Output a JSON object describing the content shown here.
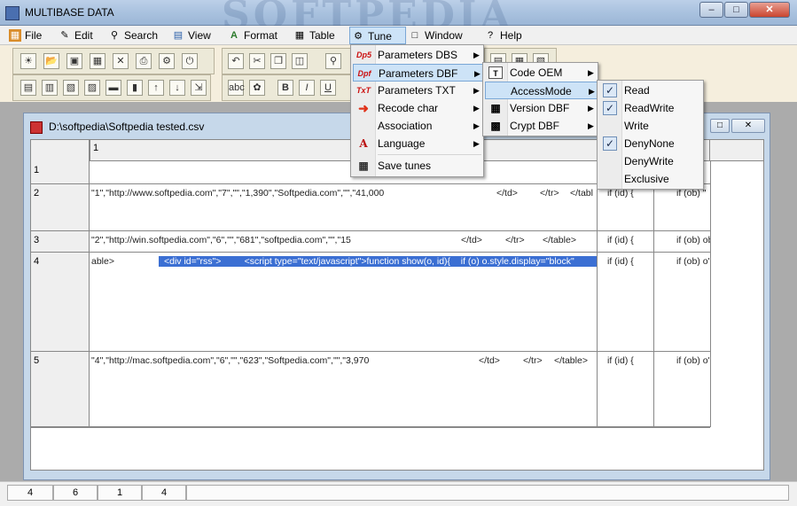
{
  "window": {
    "title": "MULTIBASE DATA",
    "watermark": "SOFTPEDIA"
  },
  "menubar": [
    {
      "label": "File",
      "icon": "file-icon"
    },
    {
      "label": "Edit",
      "icon": "edit-icon"
    },
    {
      "label": "Search",
      "icon": "search-icon"
    },
    {
      "label": "View",
      "icon": "view-icon"
    },
    {
      "label": "Format",
      "icon": "format-icon"
    },
    {
      "label": "Table",
      "icon": "table-icon"
    },
    {
      "label": "Tune",
      "icon": "tune-icon"
    },
    {
      "label": "Window",
      "icon": "window-icon"
    },
    {
      "label": "Help",
      "icon": "help-icon"
    }
  ],
  "tune_menu": {
    "items": [
      {
        "label": "Parameters DBS",
        "icon": "Dp5",
        "submenu": true
      },
      {
        "label": "Parameters DBF",
        "icon": "Dpf",
        "submenu": true
      },
      {
        "label": "Parameters TXT",
        "icon": "TxT",
        "submenu": true
      },
      {
        "label": "Recode char",
        "icon": "recode",
        "submenu": true
      },
      {
        "label": "Association",
        "icon": "",
        "submenu": true
      },
      {
        "label": "Language",
        "icon": "A",
        "submenu": true
      },
      {
        "label": "Save tunes",
        "icon": "save",
        "submenu": false
      }
    ]
  },
  "dbf_menu": {
    "items": [
      {
        "label": "Code OEM",
        "icon": "T",
        "submenu": true
      },
      {
        "label": "AccessMode",
        "icon": "",
        "submenu": true
      },
      {
        "label": "Version DBF",
        "icon": "grid",
        "submenu": true
      },
      {
        "label": "Crypt DBF",
        "icon": "lock",
        "submenu": true
      }
    ]
  },
  "access_menu": {
    "items": [
      {
        "label": "Read",
        "checked": true
      },
      {
        "label": "ReadWrite",
        "checked": true
      },
      {
        "label": "Write",
        "checked": false
      },
      {
        "label": "DenyNone",
        "checked": true
      },
      {
        "label": "DenyWrite",
        "checked": false
      },
      {
        "label": "Exclusive",
        "checked": false
      }
    ]
  },
  "document": {
    "title": "D:\\softpedia\\Softpedia tested.csv",
    "column_header": "1",
    "rows": [
      {
        "num": "1",
        "text": "",
        "tail1": "",
        "tail2": "",
        "tail3": "",
        "tail4": "",
        "c2": "",
        "c3": ""
      },
      {
        "num": "2",
        "text": "\"1\",\"http://www.softpedia.com\",\"7\",\"\",\"1,390\",\"Softpedia.com\",\"\",\"41,000",
        "tail1": "</td>",
        "tail2": "</tr>",
        "tail3": "</tabl",
        "tail4": "",
        "c2": "if (id) {",
        "c3": "if (ob) \""
      },
      {
        "num": "3",
        "text": "\"2\",\"http://win.softpedia.com\",\"6\",\"\",\"681\",\"softpedia.com\",\"\",\"15",
        "tail1": "</td>",
        "tail2": "</tr>",
        "tail3": "</table>",
        "tail4": "",
        "c2": "if (id) {",
        "c3": "if (ob) ob"
      },
      {
        "num": "4",
        "text": "able>",
        "tail1": "<div id=\"rss\">",
        "tail2": "<script type=\"text/javascript\">function show(o, id){",
        "tail3": "if (o) o.style.display=\"block\"",
        "tail4": "",
        "c2": "if (id) {",
        "c3": "if (ob) o'"
      },
      {
        "num": "5",
        "text": "\"4\",\"http://mac.softpedia.com\",\"6\",\"\",\"623\",\"Softpedia.com\",\"\",\"3,970",
        "tail1": "</td>",
        "tail2": "</tr>",
        "tail3": "</table>",
        "tail4": "",
        "c2": "if (id) {",
        "c3": "if (ob) o'"
      }
    ]
  },
  "statusbar": [
    "4",
    "6",
    "1",
    "4"
  ]
}
